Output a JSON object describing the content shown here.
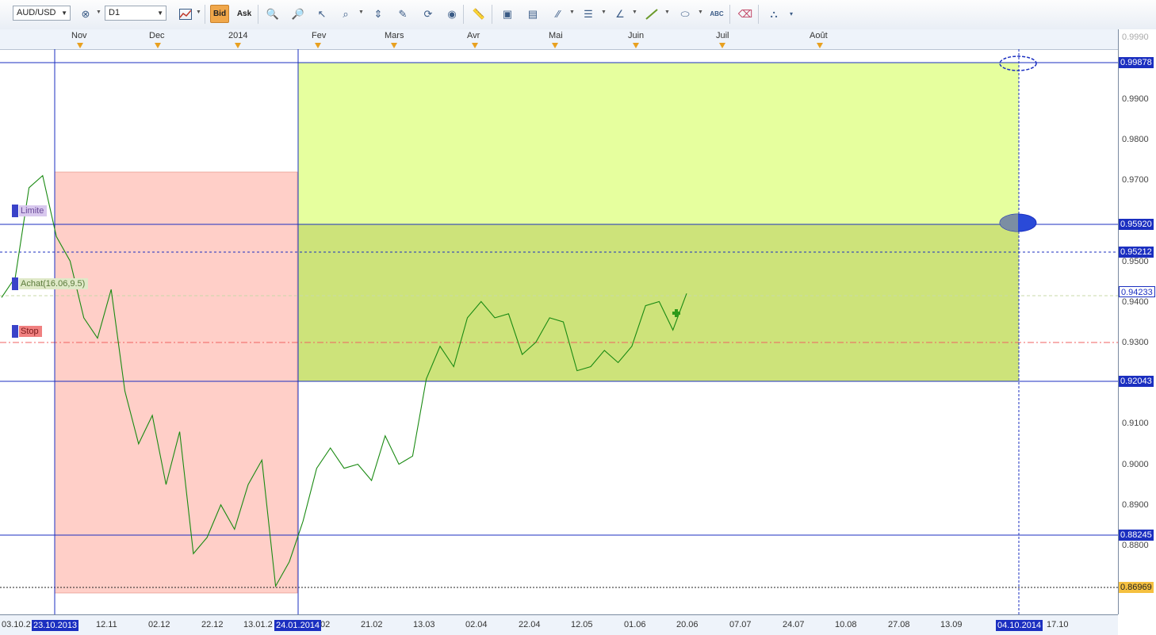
{
  "toolbar": {
    "symbol": "AUD/USD",
    "timeframe": "D1",
    "bid_label": "Bid",
    "ask_label": "Ask"
  },
  "colors": {
    "price_line": "#1a8a12",
    "tag_blue": "#1b2fc0",
    "target_zone": "#e6ff9e",
    "range_zone": "#cde37a",
    "sell_zone": "#ffcfc8",
    "stop": "#f06060"
  },
  "months": [
    "Nov",
    "Dec",
    "2014",
    "Fev",
    "Mars",
    "Avr",
    "Mai",
    "Juin",
    "Juil",
    "Août"
  ],
  "price_ticks": [
    "0.9900",
    "0.9800",
    "0.9700",
    "0.9500",
    "0.9400",
    "0.9300",
    "0.9100",
    "0.9000",
    "0.8900",
    "0.8800"
  ],
  "price_tags": {
    "top": "0.99878",
    "upper": "0.95920",
    "mid": "0.95212",
    "current": "0.94233",
    "lower": "0.92043",
    "support": "0.88245",
    "low": "0.86969"
  },
  "dates": [
    "03.10.2",
    "12.11",
    "02.12",
    "22.12",
    "13.01.2",
    "02",
    "21.02",
    "13.03",
    "02.04",
    "22.04",
    "12.05",
    "01.06",
    "20.06",
    "07.07",
    "24.07",
    "10.08",
    "27.08",
    "13.09",
    "17.10"
  ],
  "date_tags": {
    "start": "23.10.2013",
    "mid": "24.01.2014",
    "end": "04.10.2014"
  },
  "orders": {
    "limit": "Limite",
    "buy": "Achat(16.06,9.5)",
    "stop": "Stop"
  },
  "chart_data": {
    "type": "line",
    "symbol": "AUD/USD",
    "timeframe": "D1",
    "x": [
      "03.10.2013",
      "12.10",
      "22.10",
      "25.10",
      "01.11",
      "06.11",
      "12.11",
      "17.11",
      "22.11",
      "27.11",
      "02.12",
      "07.12",
      "12.12",
      "17.12",
      "22.12",
      "27.12",
      "03.01",
      "08.01",
      "13.01",
      "18.01",
      "24.01",
      "29.01",
      "03.02",
      "08.02",
      "14.02",
      "20.02",
      "25.02",
      "02.03",
      "08.03",
      "13.03",
      "18.03",
      "24.03",
      "29.03",
      "02.04",
      "07.04",
      "12.04",
      "17.04",
      "22.04",
      "28.04",
      "03.05",
      "07.05",
      "12.05",
      "18.05",
      "23.05",
      "28.05",
      "01.06",
      "06.06",
      "10.06",
      "14.06",
      "17.06",
      "20.06"
    ],
    "series": [
      {
        "values": [
          0.941,
          0.946,
          0.968,
          0.971,
          0.956,
          0.95,
          0.936,
          0.931,
          0.943,
          0.918,
          0.905,
          0.912,
          0.895,
          0.908,
          0.878,
          0.882,
          0.89,
          0.884,
          0.895,
          0.901,
          0.87,
          0.876,
          0.886,
          0.899,
          0.904,
          0.899,
          0.9,
          0.896,
          0.907,
          0.9,
          0.902,
          0.921,
          0.929,
          0.924,
          0.936,
          0.94,
          0.936,
          0.937,
          0.927,
          0.93,
          0.936,
          0.935,
          0.923,
          0.924,
          0.928,
          0.925,
          0.929,
          0.939,
          0.94,
          0.933,
          0.942
        ]
      }
    ],
    "levels": [
      0.99878,
      0.9592,
      0.95212,
      0.94233,
      0.92043,
      0.88245,
      0.86969
    ],
    "ylim": [
      0.865,
      1.0
    ]
  }
}
